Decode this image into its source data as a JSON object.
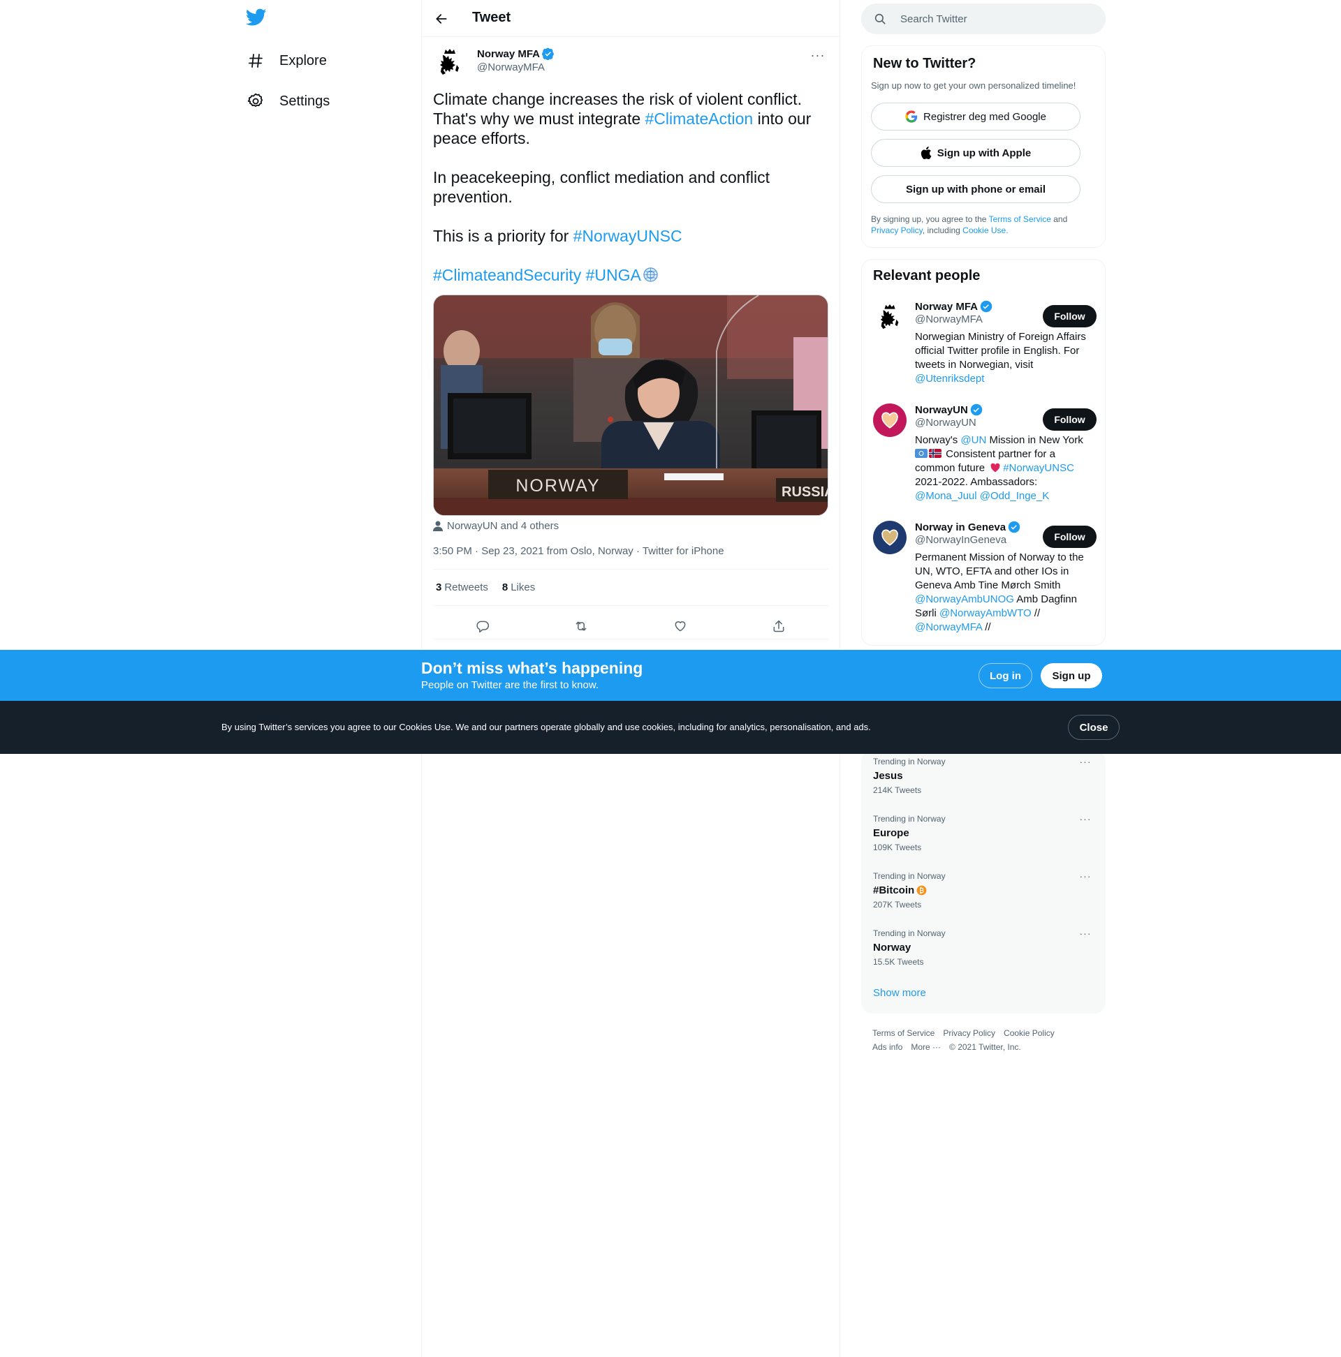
{
  "nav": {
    "items": [
      {
        "label": "Explore",
        "icon": "hashtag-icon"
      },
      {
        "label": "Settings",
        "icon": "gear-icon"
      }
    ]
  },
  "header": {
    "title": "Tweet"
  },
  "tweet": {
    "author_name": "Norway MFA",
    "author_handle": "@NorwayMFA",
    "text": {
      "p1_a": "Climate change increases the risk of violent conflict. That's why we must integrate ",
      "p1_tag": "#ClimateAction",
      "p1_b": " into our peace efforts.",
      "p2": "In peacekeeping, conflict mediation and conflict prevention.",
      "p3_a": "This is a priority for ",
      "p3_tag": "#NorwayUNSC",
      "p4_tag1": "#ClimateandSecurity",
      "p4_tag2": "#UNGA"
    },
    "media": {
      "nameplate_left": "NORWAY",
      "nameplate_right": "RUSSIAN"
    },
    "tagged": "NorwayUN and 4 others",
    "meta": "3:50 PM · Sep 23, 2021 from Oslo, Norway · Twitter for iPhone",
    "stats": {
      "retweets_count": "3",
      "retweets_label": "Retweets",
      "likes_count": "8",
      "likes_label": "Likes"
    }
  },
  "search": {
    "placeholder": "Search Twitter"
  },
  "new_to_twitter": {
    "title": "New to Twitter?",
    "subtitle": "Sign up now to get your own personalized timeline!",
    "google": "Registrer deg med Google",
    "apple": "Sign up with Apple",
    "phone": "Sign up with phone or email",
    "legal": {
      "a": "By signing up, you agree to the ",
      "tos": "Terms of Service",
      "b": " and ",
      "privacy": "Privacy Policy",
      "c": ", including ",
      "cookie": "Cookie Use",
      "d": "."
    }
  },
  "relevant": {
    "title": "Relevant people",
    "follow_label": "Follow",
    "people": [
      {
        "name": "Norway MFA",
        "handle": "@NorwayMFA",
        "bio_a": "Norwegian Ministry of Foreign Affairs official Twitter profile in English. For tweets in Norwegian, visit ",
        "bio_link": "@Utenriksdept"
      },
      {
        "name": "NorwayUN",
        "handle": "@NorwayUN",
        "bio_a": "Norway's ",
        "bio_link1": "@UN",
        "bio_b": " Mission in New York ",
        "bio_c": " Consistent partner for a common future ",
        "bio_link2": "#NorwayUNSC",
        "bio_d": " 2021-2022. Ambassadors: ",
        "bio_link3": "@Mona_Juul",
        "bio_link4": "@Odd_Inge_K"
      },
      {
        "name": "Norway in Geneva",
        "handle": "@NorwayInGeneva",
        "bio_a": "Permanent Mission of Norway to the UN, WTO, EFTA and other IOs in Geneva Amb Tine Mørch Smith ",
        "bio_link1": "@NorwayAmbUNOG",
        "bio_b": " Amb Dagfinn Sørli ",
        "bio_link2": "@NorwayAmbWTO",
        "bio_c": " // ",
        "bio_link3": "@NorwayMFA",
        "bio_d": " //"
      }
    ]
  },
  "trends": {
    "items": [
      {
        "context": "Trending in Norway",
        "name": "Jesus",
        "count": "214K Tweets"
      },
      {
        "context": "Trending in Norway",
        "name": "Europe",
        "count": "109K Tweets"
      },
      {
        "context": "Trending in Norway",
        "name": "#Bitcoin",
        "count": "207K Tweets"
      },
      {
        "context": "Trending in Norway",
        "name": "Norway",
        "count": "15.5K Tweets"
      }
    ],
    "show_more": "Show more"
  },
  "footer": {
    "links": [
      "Terms of Service",
      "Privacy Policy",
      "Cookie Policy",
      "Ads info",
      "More ···",
      "© 2021 Twitter, Inc."
    ]
  },
  "banner": {
    "title": "Don’t miss what’s happening",
    "subtitle": "People on Twitter are the first to know.",
    "login": "Log in",
    "signup": "Sign up"
  },
  "cookie_bar": {
    "text": "By using Twitter’s services you agree to our Cookies Use. We and our partners operate globally and use cookies, including for analytics, personalisation, and ads.",
    "close": "Close"
  },
  "colors": {
    "accent": "#1d9bf0",
    "text": "#0f1419",
    "muted": "#536471",
    "cookie_bar": "#15202b",
    "norwayun_avatar": "#c2185b",
    "geneva_avatar": "#1f3a6e"
  }
}
